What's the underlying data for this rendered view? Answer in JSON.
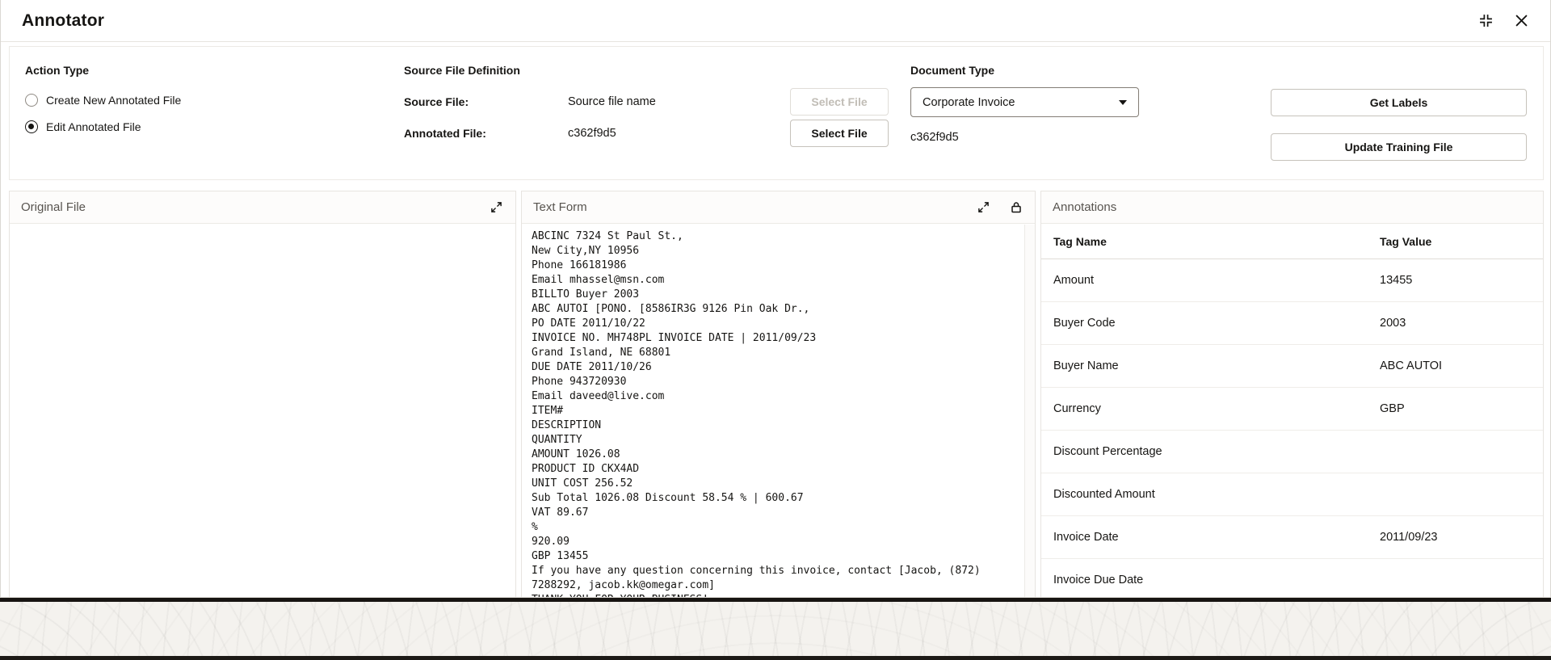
{
  "window": {
    "title": "Annotator"
  },
  "form": {
    "action_type": {
      "label": "Action Type",
      "options": [
        {
          "label": "Create New Annotated File",
          "selected": false
        },
        {
          "label": "Edit Annotated File",
          "selected": true
        }
      ]
    },
    "source_file_definition": {
      "label": "Source File Definition",
      "source_file": {
        "label": "Source File:",
        "value": "Source file name",
        "button": "Select File",
        "button_enabled": false
      },
      "annotated_file": {
        "label": "Annotated File:",
        "value": "c362f9d5",
        "button": "Select File",
        "button_enabled": true
      }
    },
    "document_type": {
      "label": "Document Type",
      "selected": "Corporate Invoice",
      "file_value": "c362f9d5"
    },
    "actions": {
      "get_labels": "Get Labels",
      "update_training_file": "Update Training File"
    }
  },
  "panels": {
    "original_file": {
      "title": "Original File"
    },
    "text_form": {
      "title": "Text Form",
      "lines": [
        "ABCINC 7324 St Paul St.,",
        "New City,NY 10956",
        "Phone 166181986",
        "Email mhassel@msn.com",
        "BILLTO Buyer 2003",
        "ABC AUTOI [PONO. [8586IR3G 9126 Pin Oak Dr.,",
        "PO DATE 2011/10/22",
        "INVOICE NO. MH748PL INVOICE DATE | 2011/09/23",
        "Grand Island, NE 68801",
        "DUE DATE 2011/10/26",
        "Phone 943720930",
        "Email daveed@live.com",
        "ITEM#",
        "DESCRIPTION",
        "QUANTITY",
        "AMOUNT 1026.08",
        "PRODUCT ID CKX4AD",
        "UNIT COST 256.52",
        "Sub Total 1026.08 Discount 58.54 % | 600.67",
        "VAT 89.67",
        "%",
        "920.09",
        "GBP 13455",
        "If you have any question concerning this invoice, contact [Jacob, (872) 7288292, jacob.kk@omegar.com]",
        "THANK YOU FOR YOUR BUSINESS!"
      ]
    },
    "annotations": {
      "title": "Annotations",
      "columns": [
        "Tag Name",
        "Tag Value"
      ],
      "rows": [
        {
          "name": "Amount",
          "value": "13455"
        },
        {
          "name": "Buyer Code",
          "value": "2003"
        },
        {
          "name": "Buyer Name",
          "value": "ABC AUTOI"
        },
        {
          "name": "Currency",
          "value": "GBP"
        },
        {
          "name": "Discount Percentage",
          "value": ""
        },
        {
          "name": "Discounted Amount",
          "value": ""
        },
        {
          "name": "Invoice Date",
          "value": "2011/09/23"
        },
        {
          "name": "Invoice Due Date",
          "value": ""
        }
      ]
    }
  },
  "icons": {
    "restore_window": "corner-brackets",
    "close": "x-mark",
    "expand": "diagonal-arrows",
    "lock": "closed-padlock",
    "dropdown": "caret-down",
    "scroll_down": "caret-down-small"
  },
  "colors": {
    "text": "#161513",
    "muted": "#58544f",
    "border": "#e7e4e0",
    "dark_bar": "#171411",
    "disabled_text": "#c1bdb6"
  }
}
